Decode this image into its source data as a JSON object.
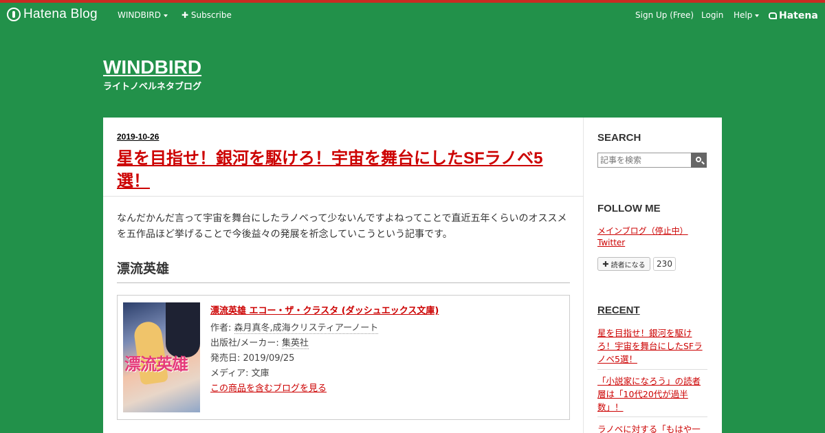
{
  "global_header": {
    "logo_text": "Hatena Blog",
    "blog_menu": "WINDBIRD",
    "subscribe": "Subscribe",
    "sign_up": "Sign Up (Free)",
    "login": "Login",
    "help": "Help",
    "hatena": "Hatena"
  },
  "blog": {
    "title": "WINDBIRD",
    "description": "ライトノベルネタブログ"
  },
  "entry": {
    "date": "2019-10-26",
    "title": "星を目指せ！銀河を駆けろ！宇宙を舞台にしたSFラノベ5選！",
    "intro": "なんだかんだ言って宇宙を舞台にしたラノベって少ないんですよねってことで直近五年くらいのオススメを五作品ほど挙げることで今後益々の発展を祈念していこうという記事です。",
    "section_heading": "漂流英雄",
    "product": {
      "cover_text": "漂流英雄",
      "title": "漂流英雄 エコー・ザ・クラスタ (ダッシュエックス文庫)",
      "author_label": "作者: ",
      "author": "森月真冬,成海クリスティアーノート",
      "publisher_label": "出版社/メーカー: ",
      "publisher": "集英社",
      "release_label": "発売日: ",
      "release": "2019/09/25",
      "media_label": "メディア: ",
      "media": "文庫",
      "blog_link": "この商品を含むブログを見る"
    }
  },
  "sidebar": {
    "search_heading": "SEARCH",
    "search_placeholder": "記事を検索",
    "follow_heading": "FOLLOW ME",
    "follow_links": [
      "メインブログ（停止中）",
      "Twitter"
    ],
    "reader_button": "読者になる",
    "reader_count": "230",
    "recent_heading": "RECENT",
    "recent_items": [
      "星を目指せ！銀河を駆けろ！宇宙を舞台にしたSFラノベ5選！",
      "「小説家になろう」の読者層は「10代20代が過半数」！",
      "ラノベに対する「もはや一"
    ]
  },
  "colors": {
    "background": "#22914a",
    "accent_red": "#c92b22",
    "link": "#cc0000"
  }
}
